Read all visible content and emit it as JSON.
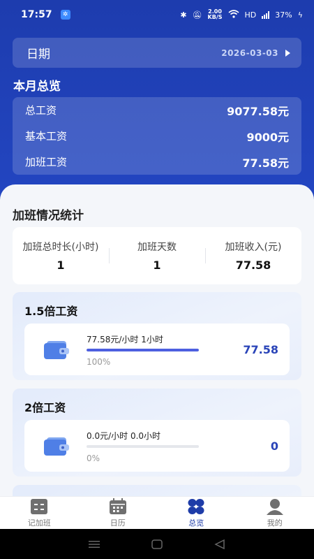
{
  "status_bar": {
    "time": "17:57",
    "network_speed": "2.00\nKB/S",
    "hd": "HD",
    "network_type": "5G",
    "battery": "37%"
  },
  "date": {
    "label": "日期",
    "value": "2026-03-03"
  },
  "monthly_overview": {
    "title": "本月总览",
    "rows": [
      {
        "label": "总工资",
        "value": "9077.58元"
      },
      {
        "label": "基本工资",
        "value": "9000元"
      },
      {
        "label": "加班工资",
        "value": "77.58元"
      }
    ]
  },
  "overtime_stats": {
    "title": "加班情况统计",
    "items": [
      {
        "label": "加班总时长(小时)",
        "value": "1"
      },
      {
        "label": "加班天数",
        "value": "1"
      },
      {
        "label": "加班收入(元)",
        "value": "77.58"
      }
    ]
  },
  "rate_groups": [
    {
      "title": "1.5倍工资",
      "detail": "77.58元/小时 1小时",
      "percent_text": "100%",
      "progress": 1.0,
      "amount": "77.58"
    },
    {
      "title": "2倍工资",
      "detail": "0.0元/小时 0.0小时",
      "percent_text": "0%",
      "progress": 0.0,
      "amount": "0"
    }
  ],
  "tabbar": {
    "items": [
      {
        "label": "记加班",
        "icon": "calculator-icon",
        "active": false
      },
      {
        "label": "日历",
        "icon": "calendar-icon",
        "active": false
      },
      {
        "label": "总览",
        "icon": "overview-grid-icon",
        "active": true
      },
      {
        "label": "我的",
        "icon": "user-icon",
        "active": false
      }
    ]
  },
  "colors": {
    "primary": "#1f3fb6",
    "accent_text": "#2a44b8",
    "progress_fill": "#4d5fe0",
    "tab_active": "#1e3ca8"
  }
}
